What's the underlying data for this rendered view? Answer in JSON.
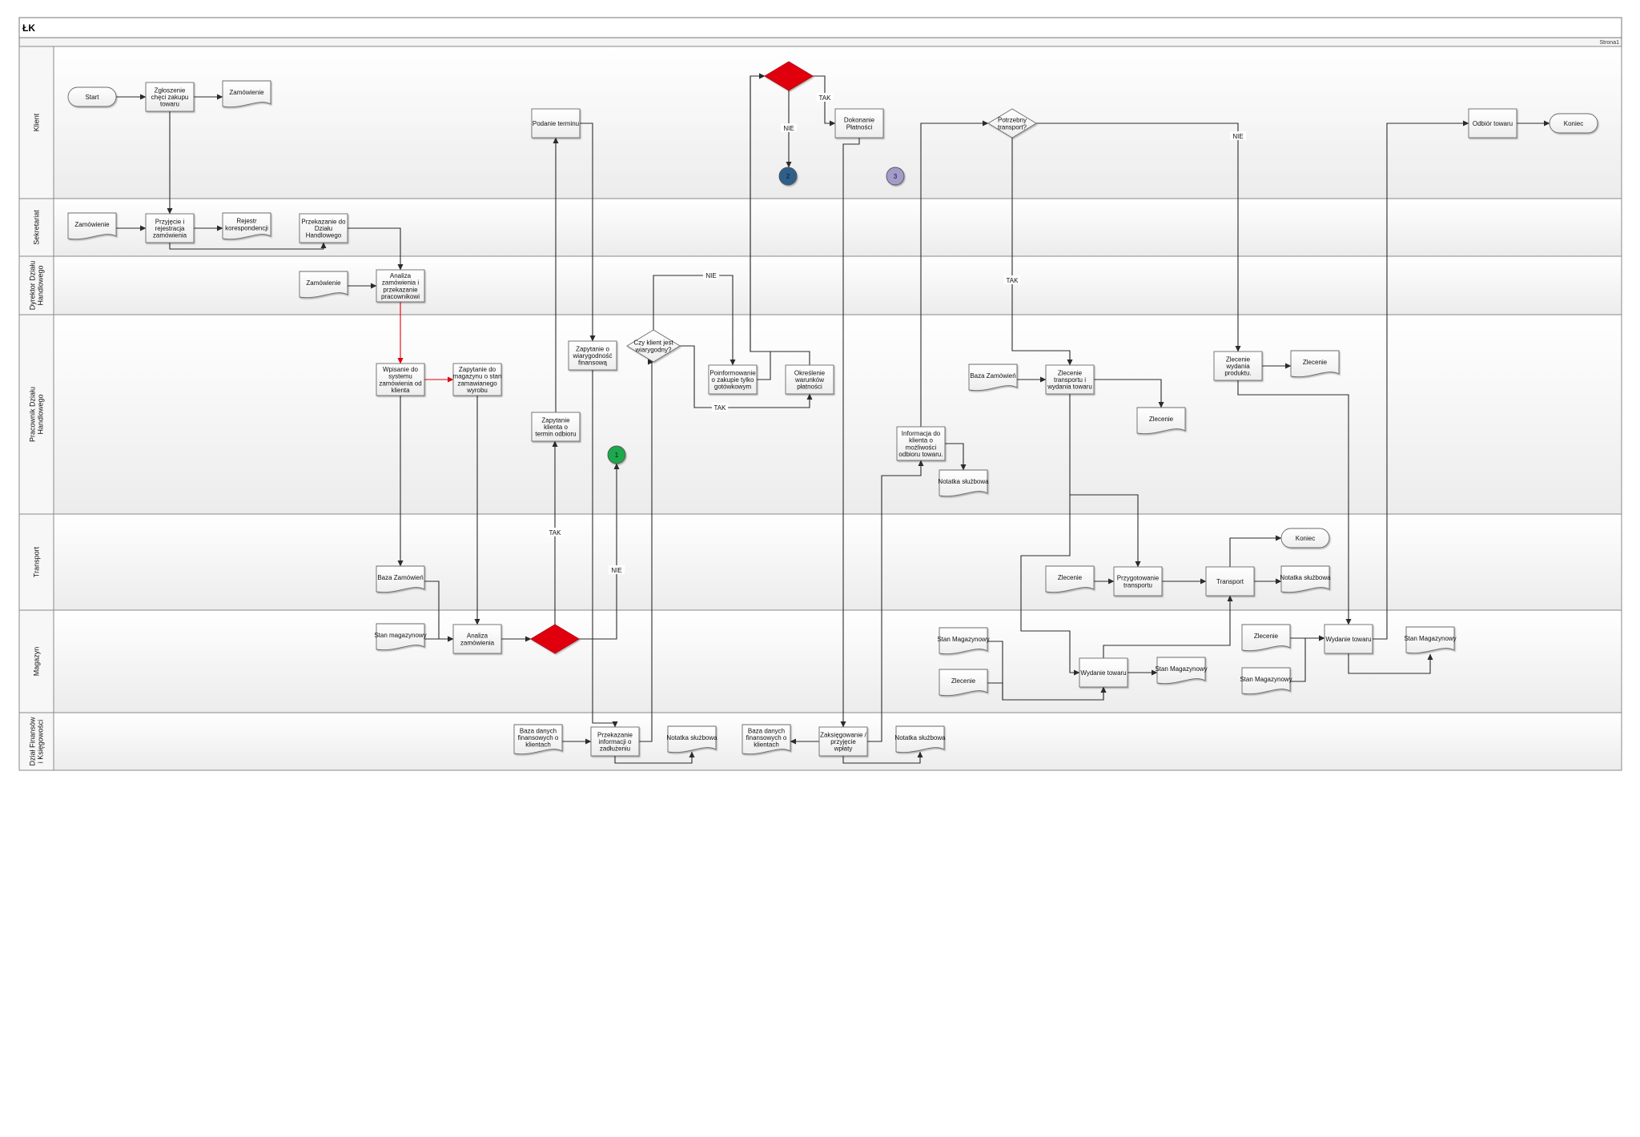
{
  "title": "ŁK",
  "page_label": "Strona1",
  "colors": {
    "decision_red": "#e0000b",
    "connector_blue": "#2e5f8a",
    "connector_purple": "#a39bc9",
    "connector_green": "#1ea84b",
    "red_flow": "#e0000b",
    "line": "#2b2b2b"
  },
  "lanes": [
    {
      "id": "klient",
      "label": "Klient"
    },
    {
      "id": "sekretariat",
      "label": "Sekretariat"
    },
    {
      "id": "dyrektor",
      "label": "Dyrektor Działu Handlowego"
    },
    {
      "id": "pracownik",
      "label": "Pracownik Działu Handlowego"
    },
    {
      "id": "transport",
      "label": "Transport"
    },
    {
      "id": "magazyn",
      "label": "Magazyn"
    },
    {
      "id": "finanse",
      "label": "Dział Finansów i Księgowości"
    }
  ],
  "nodes": [
    {
      "id": "start",
      "type": "terminator",
      "lane": "klient",
      "text": "Start"
    },
    {
      "id": "zgloszenie",
      "type": "process",
      "lane": "klient",
      "text": "Zgłoszenie chęci zakupu towaru"
    },
    {
      "id": "zam_k",
      "type": "document",
      "lane": "klient",
      "text": "Zamówienie"
    },
    {
      "id": "podanie",
      "type": "process",
      "lane": "klient",
      "text": "Podanie terminu"
    },
    {
      "id": "dec_k",
      "type": "decision_red",
      "lane": "klient",
      "text": ""
    },
    {
      "id": "c2",
      "type": "connector",
      "lane": "klient",
      "text": "2",
      "color": "connector_blue"
    },
    {
      "id": "dokonanie",
      "type": "process",
      "lane": "klient",
      "text": "Dokonanie Płatności"
    },
    {
      "id": "c3",
      "type": "connector",
      "lane": "klient",
      "text": "3",
      "color": "connector_purple"
    },
    {
      "id": "potrzebny",
      "type": "decision",
      "lane": "klient",
      "text": "Potrzebny transport?"
    },
    {
      "id": "odbior",
      "type": "process",
      "lane": "klient",
      "text": "Odbiór towaru"
    },
    {
      "id": "koniec1",
      "type": "terminator",
      "lane": "klient",
      "text": "Koniec"
    },
    {
      "id": "zam_s",
      "type": "document",
      "lane": "sekretariat",
      "text": "Zamówienie"
    },
    {
      "id": "przyjecie",
      "type": "process",
      "lane": "sekretariat",
      "text": "Przyjęcie i rejestracja zamówienia"
    },
    {
      "id": "rejestr",
      "type": "document",
      "lane": "sekretariat",
      "text": "Rejestr korespondencji"
    },
    {
      "id": "przekazanie",
      "type": "process",
      "lane": "sekretariat",
      "text": "Przekazanie do Działu Handlowego"
    },
    {
      "id": "zam_d",
      "type": "document",
      "lane": "dyrektor",
      "text": "Zamówienie"
    },
    {
      "id": "analiza1",
      "type": "process",
      "lane": "dyrektor",
      "text": "Analiza zamówienia i przekazanie pracownikowi"
    },
    {
      "id": "wpisanie",
      "type": "process",
      "lane": "pracownik",
      "text": "Wpisanie do systemu zamówienia od klienta"
    },
    {
      "id": "zapytanie_mag",
      "type": "process",
      "lane": "pracownik",
      "text": "Zapytanie do magazynu o stan zamawianego wyrobu"
    },
    {
      "id": "zapytanie_klienta",
      "type": "process",
      "lane": "pracownik",
      "text": "Zapytanie klienta o termin odbioru"
    },
    {
      "id": "zapytanie_wiar",
      "type": "process",
      "lane": "pracownik",
      "text": "Zapytanie o wiarygodność finansową"
    },
    {
      "id": "czy_klient",
      "type": "decision",
      "lane": "pracownik",
      "text": "Czy klient jest wiarygodny?"
    },
    {
      "id": "c1",
      "type": "connector",
      "lane": "pracownik",
      "text": "1",
      "color": "connector_green"
    },
    {
      "id": "poinformowanie",
      "type": "process",
      "lane": "pracownik",
      "text": "Poinformowanie o zakupie tylko gotówkowym"
    },
    {
      "id": "okreslenie",
      "type": "process",
      "lane": "pracownik",
      "text": "Określenie warunków płatności"
    },
    {
      "id": "informacja",
      "type": "process",
      "lane": "pracownik",
      "text": "Informacja do klienta o możliwości odbioru towaru."
    },
    {
      "id": "notatka_p",
      "type": "document",
      "lane": "pracownik",
      "text": "Notatka służbowa"
    },
    {
      "id": "baza_zam_p",
      "type": "document",
      "lane": "pracownik",
      "text": "Baza Zamówień"
    },
    {
      "id": "zlecenie_tw",
      "type": "process",
      "lane": "pracownik",
      "text": "Zlecenie transportu i wydania towaru"
    },
    {
      "id": "zlecenie_p1",
      "type": "document",
      "lane": "pracownik",
      "text": "Zlecenie"
    },
    {
      "id": "zlecenie_wyd",
      "type": "process",
      "lane": "pracownik",
      "text": "Zlecenie wydania produktu."
    },
    {
      "id": "zlecenie_p2",
      "type": "document",
      "lane": "pracownik",
      "text": "Zlecenie"
    },
    {
      "id": "baza_zam_t",
      "type": "document",
      "lane": "transport",
      "text": "Baza Zamówień"
    },
    {
      "id": "zlecenie_t",
      "type": "document",
      "lane": "transport",
      "text": "Zlecenie"
    },
    {
      "id": "przygotowanie",
      "type": "process",
      "lane": "transport",
      "text": "Przygotowanie transportu"
    },
    {
      "id": "transport_p",
      "type": "process",
      "lane": "transport",
      "text": "Transport"
    },
    {
      "id": "koniec2",
      "type": "terminator",
      "lane": "transport",
      "text": "Koniec"
    },
    {
      "id": "notatka_t",
      "type": "document",
      "lane": "transport",
      "text": "Notatka służbowa"
    },
    {
      "id": "stan_mag1",
      "type": "document",
      "lane": "magazyn",
      "text": "Stan magazynowy"
    },
    {
      "id": "analiza2",
      "type": "process",
      "lane": "magazyn",
      "text": "Analiza zamówienia"
    },
    {
      "id": "dec_m",
      "type": "decision_red",
      "lane": "magazyn",
      "text": ""
    },
    {
      "id": "stan_mag2",
      "type": "document",
      "lane": "magazyn",
      "text": "Stan Magazynowy"
    },
    {
      "id": "zlecenie_m1",
      "type": "document",
      "lane": "magazyn",
      "text": "Zlecenie"
    },
    {
      "id": "wydanie1",
      "type": "process",
      "lane": "magazyn",
      "text": "Wydanie towaru"
    },
    {
      "id": "stan_mag3",
      "type": "document",
      "lane": "magazyn",
      "text": "Stan Magazynowy"
    },
    {
      "id": "zlecenie_m2",
      "type": "document",
      "lane": "magazyn",
      "text": "Zlecenie"
    },
    {
      "id": "stan_mag4",
      "type": "document",
      "lane": "magazyn",
      "text": "Stan Magazynowy"
    },
    {
      "id": "wydanie2",
      "type": "process",
      "lane": "magazyn",
      "text": "Wydanie towaru"
    },
    {
      "id": "stan_mag5",
      "type": "document",
      "lane": "magazyn",
      "text": "Stan Magazynowy"
    },
    {
      "id": "baza_fin1",
      "type": "document",
      "lane": "finanse",
      "text": "Baza danych finansowych o klientach"
    },
    {
      "id": "przekazanie_inf",
      "type": "process",
      "lane": "finanse",
      "text": "Przekazanie informacji o zadłużeniu"
    },
    {
      "id": "notatka_f1",
      "type": "document",
      "lane": "finanse",
      "text": "Notatka służbowa"
    },
    {
      "id": "baza_fin2",
      "type": "document",
      "lane": "finanse",
      "text": "Baza danych finansowych o klientach"
    },
    {
      "id": "zaksiegowanie",
      "type": "process",
      "lane": "finanse",
      "text": "Zaksięgowanie / przyjęcie wpłaty"
    },
    {
      "id": "notatka_f2",
      "type": "document",
      "lane": "finanse",
      "text": "Notatka służbowa"
    }
  ],
  "edges": [
    {
      "from": "start",
      "to": "zgloszenie"
    },
    {
      "from": "zgloszenie",
      "to": "zam_k"
    },
    {
      "from": "zgloszenie",
      "to": "przyjecie"
    },
    {
      "from": "zam_s",
      "to": "przyjecie"
    },
    {
      "from": "przyjecie",
      "to": "rejestr"
    },
    {
      "from": "przyjecie",
      "to": "przekazanie"
    },
    {
      "from": "przekazanie",
      "to": "analiza1"
    },
    {
      "from": "zam_d",
      "to": "analiza1"
    },
    {
      "from": "analiza1",
      "to": "wpisanie",
      "color": "red"
    },
    {
      "from": "wpisanie",
      "to": "zapytanie_mag",
      "color": "red"
    },
    {
      "from": "wpisanie",
      "to": "baza_zam_t"
    },
    {
      "from": "baza_zam_t",
      "to": "analiza2"
    },
    {
      "from": "zapytanie_mag",
      "to": "analiza2"
    },
    {
      "from": "stan_mag1",
      "to": "analiza2"
    },
    {
      "from": "analiza2",
      "to": "dec_m"
    },
    {
      "from": "dec_m",
      "to": "zapytanie_klienta",
      "label": "TAK"
    },
    {
      "from": "dec_m",
      "to": "c1",
      "label": "NIE"
    },
    {
      "from": "zapytanie_klienta",
      "to": "podanie"
    },
    {
      "from": "podanie",
      "to": "zapytanie_wiar"
    },
    {
      "from": "zapytanie_wiar",
      "to": "przekazanie_inf"
    },
    {
      "from": "baza_fin1",
      "to": "przekazanie_inf"
    },
    {
      "from": "przekazanie_inf",
      "to": "czy_klient"
    },
    {
      "from": "przekazanie_inf",
      "to": "notatka_f1"
    },
    {
      "from": "czy_klient",
      "to": "poinformowanie",
      "label": "NIE"
    },
    {
      "from": "czy_klient",
      "to": "okreslenie",
      "label": "TAK"
    },
    {
      "from": "poinformowanie",
      "to": "dec_k"
    },
    {
      "from": "okreslenie",
      "to": "dec_k"
    },
    {
      "from": "dec_k",
      "to": "c2",
      "label": "NIE"
    },
    {
      "from": "dec_k",
      "to": "dokonanie",
      "label": "TAK"
    },
    {
      "from": "dokonanie",
      "to": "zaksiegowanie"
    },
    {
      "from": "zaksiegowanie",
      "to": "baza_fin2"
    },
    {
      "from": "zaksiegowanie",
      "to": "notatka_f2"
    },
    {
      "from": "zaksiegowanie",
      "to": "informacja"
    },
    {
      "from": "informacja",
      "to": "notatka_p"
    },
    {
      "from": "informacja",
      "to": "potrzebny"
    },
    {
      "from": "potrzebny",
      "to": "zlecenie_tw",
      "label": "TAK"
    },
    {
      "from": "potrzebny",
      "to": "zlecenie_wyd",
      "label": "NIE"
    },
    {
      "from": "baza_zam_p",
      "to": "zlecenie_tw"
    },
    {
      "from": "zlecenie_tw",
      "to": "zlecenie_p1"
    },
    {
      "from": "zlecenie_tw",
      "to": "przygotowanie"
    },
    {
      "from": "zlecenie_tw",
      "to": "wydanie1"
    },
    {
      "from": "zlecenie_t",
      "to": "przygotowanie"
    },
    {
      "from": "przygotowanie",
      "to": "transport_p"
    },
    {
      "from": "transport_p",
      "to": "koniec2"
    },
    {
      "from": "transport_p",
      "to": "notatka_t"
    },
    {
      "from": "stan_mag2",
      "to": "wydanie1"
    },
    {
      "from": "zlecenie_m1",
      "to": "wydanie1"
    },
    {
      "from": "wydanie1",
      "to": "stan_mag3"
    },
    {
      "from": "wydanie1",
      "to": "transport_p"
    },
    {
      "from": "zlecenie_wyd",
      "to": "zlecenie_p2"
    },
    {
      "from": "zlecenie_wyd",
      "to": "wydanie2"
    },
    {
      "from": "zlecenie_m2",
      "to": "wydanie2"
    },
    {
      "from": "stan_mag4",
      "to": "wydanie2"
    },
    {
      "from": "wydanie2",
      "to": "stan_mag5"
    },
    {
      "from": "wydanie2",
      "to": "odbior"
    },
    {
      "from": "odbior",
      "to": "koniec1"
    }
  ]
}
